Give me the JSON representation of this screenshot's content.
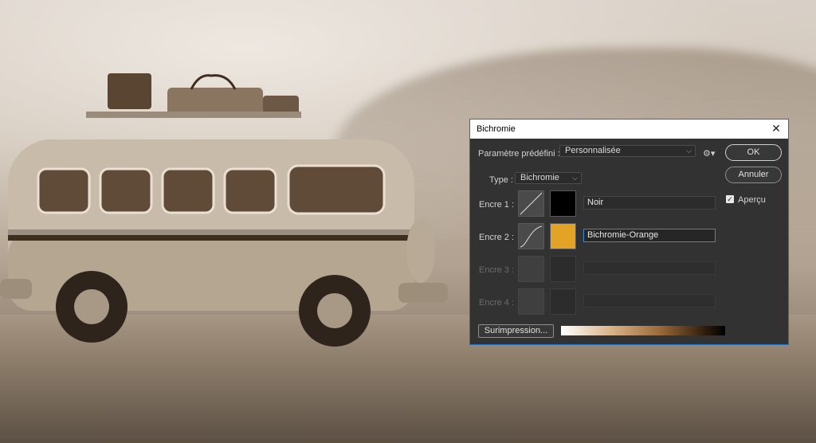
{
  "dialog": {
    "title": "Bichromie",
    "close_glyph": "✕",
    "preset": {
      "label": "Paramètre prédéfini :",
      "value": "Personnalisée"
    },
    "type": {
      "label": "Type :",
      "value": "Bichromie"
    },
    "inks": [
      {
        "label": "Encre 1 :",
        "name": "Noir",
        "color": "#000000",
        "enabled": true
      },
      {
        "label": "Encre 2 :",
        "name": "Bichromie-Orange",
        "color": "#e2a326",
        "enabled": true
      },
      {
        "label": "Encre 3 :",
        "name": "",
        "color": "",
        "enabled": false
      },
      {
        "label": "Encre 4 :",
        "name": "",
        "color": "",
        "enabled": false
      }
    ],
    "buttons": {
      "ok": "OK",
      "cancel": "Annuler",
      "overprint": "Surimpression..."
    },
    "preview": {
      "label": "Aperçu",
      "checked": true
    }
  },
  "icons": {
    "gear": "gear-icon",
    "chevron": "chevron-down-icon",
    "close": "close-icon",
    "check": "checkmark-icon"
  }
}
